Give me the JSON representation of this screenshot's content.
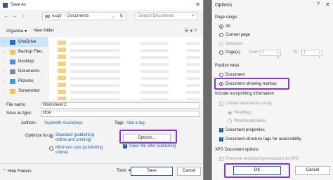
{
  "save_as": {
    "title": "Save As",
    "close": "✕",
    "nav": {
      "back": "←",
      "forward": "→",
      "up": "↑"
    },
    "address": {
      "part1": "ruupr",
      "sep": "›",
      "part2": "Documents"
    },
    "search_placeholder": "Search Documents",
    "toolbar": {
      "organise": "Organise ▾",
      "new_folder": "New folder"
    },
    "sidebar": [
      {
        "label": "OneDrive",
        "selected": true,
        "color": "#1e74d6"
      },
      {
        "label": "Backup Files",
        "selected": false,
        "color": "#f4c54b"
      },
      {
        "label": "Desktop",
        "selected": false,
        "color": "#4a8fe0"
      },
      {
        "label": "Documents",
        "selected": false,
        "color": "#7a8a9c"
      },
      {
        "label": "Pictures",
        "selected": false,
        "color": "#3aa0d8"
      },
      {
        "label": "Screenshot",
        "selected": false,
        "color": "#f4c54b"
      }
    ],
    "file_name_label": "File name:",
    "file_name": "Worksheet 2",
    "save_as_type_label": "Save as type:",
    "save_as_type": "PDF",
    "authors_label": "Authors:",
    "authors": "Supreeth Koundinya",
    "tags_label": "Tags:",
    "tags": "Add a tag",
    "optimize_label": "Optimize for:",
    "optimize_standard": "Standard (publishing online and printing)",
    "optimize_minimum": "Minimum size (publishing online)",
    "options_button": "Options...",
    "open_after": "Open file after publishing",
    "hide_folders": "⌃ Hide Folders",
    "tools": "Tools",
    "save": "Save",
    "cancel": "Cancel"
  },
  "options": {
    "title": "Options",
    "help": "?",
    "close": "✕",
    "page_range_heading": "Page range",
    "all": "All",
    "current_page": "Current page",
    "selection": "Selection",
    "pages": "Page(s)",
    "from_label": "From:",
    "from_value": "1",
    "to_label": "To:",
    "to_value": "1",
    "publish_heading": "Publish what",
    "document": "Document",
    "document_markup": "Document showing markup",
    "nonprinting_heading": "Include non-printing information",
    "create_bookmarks": "Create bookmarks using:",
    "headings": "Headings",
    "word_bookmarks": "Word bookmarks",
    "doc_properties": "Document properties",
    "doc_structure": "Document structure tags for accessibility",
    "xps_heading": "XPS Document options",
    "preserve": "Preserve restricted permissions in XPS",
    "ok": "OK",
    "cancel": "Cancel"
  },
  "colors": {
    "accent": "#1a62b8",
    "highlight": "#8d35d2"
  }
}
